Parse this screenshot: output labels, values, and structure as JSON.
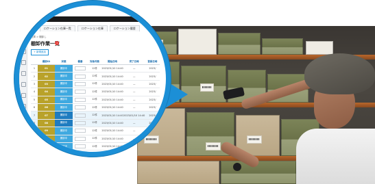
{
  "app": {
    "tabs": [
      "ロケーション在庫一覧",
      "ロケーション在庫",
      "ロケーション履歴"
    ],
    "breadcrumb": "在庫 > 棚卸し",
    "title": "棚卸作業一覧",
    "badge": "1",
    "new_button": "+ 新規追加"
  },
  "table": {
    "columns": [
      "棚卸ID",
      "状態",
      "棚番",
      "対象件数",
      "開始日時",
      "完了日時",
      "登録日時"
    ],
    "rows": [
      {
        "num": "1",
        "id": "01",
        "status": "棚卸中",
        "qty": "12件",
        "start": "2023/01/10 14:40",
        "end": "—",
        "reg": "2023/"
      },
      {
        "num": "2",
        "id": "02",
        "status": "棚卸中",
        "qty": "12件",
        "start": "2023/01/10 14:40",
        "end": "—",
        "reg": "2023/"
      },
      {
        "num": "3",
        "id": "03",
        "status": "棚卸中",
        "qty": "12件",
        "start": "2023/01/10 14:40",
        "end": "—",
        "reg": "2023/"
      },
      {
        "num": "4",
        "id": "04",
        "status": "棚卸中",
        "qty": "12件",
        "start": "2023/01/10 14:40",
        "end": "—",
        "reg": "2023/"
      },
      {
        "num": "5",
        "id": "05",
        "status": "棚卸中",
        "qty": "12件",
        "start": "2023/01/10 14:40",
        "end": "—",
        "reg": "2023/"
      },
      {
        "num": "6",
        "id": "06",
        "status": "棚卸中",
        "qty": "12件",
        "start": "2023/01/10 14:40",
        "end": "—",
        "reg": "2023/"
      },
      {
        "num": "7",
        "id": "07",
        "status": "棚卸中",
        "qty": "12件",
        "start": "2023/01/10 14:40",
        "end": "2023/01/10 14:40",
        "reg": "2023/"
      },
      {
        "num": "8",
        "id": "08",
        "status": "棚卸中",
        "qty": "12件",
        "start": "2023/01/10 14:40",
        "end": "—",
        "reg": "2023/"
      },
      {
        "num": "9",
        "id": "09",
        "status": "棚卸中",
        "qty": "12件",
        "start": "2023/01/10 14:40",
        "end": "—",
        "reg": "2023/"
      },
      {
        "num": "10",
        "id": "10",
        "status": "棚卸中",
        "qty": "12件",
        "start": "2023/01/10 14:40",
        "end": "—",
        "reg": "2023/"
      },
      {
        "num": "11",
        "id": "11",
        "status": "棚卸中",
        "qty": "12件",
        "start": "2023/01/10 14:40",
        "end": "—",
        "reg": "2023/"
      },
      {
        "num": "12",
        "id": "12",
        "status": "棚卸中",
        "qty": "12件",
        "start": "2023/01/10 14:40",
        "end": "—",
        "reg": "2023/"
      }
    ]
  },
  "colors": {
    "accent": "#1c8fd6",
    "id_cell": "#b9a22a",
    "status_cell": "#3fa9e0",
    "badge": "#e53935"
  },
  "icons": [
    "sidebar-nav-icon",
    "arrow-pointer"
  ]
}
